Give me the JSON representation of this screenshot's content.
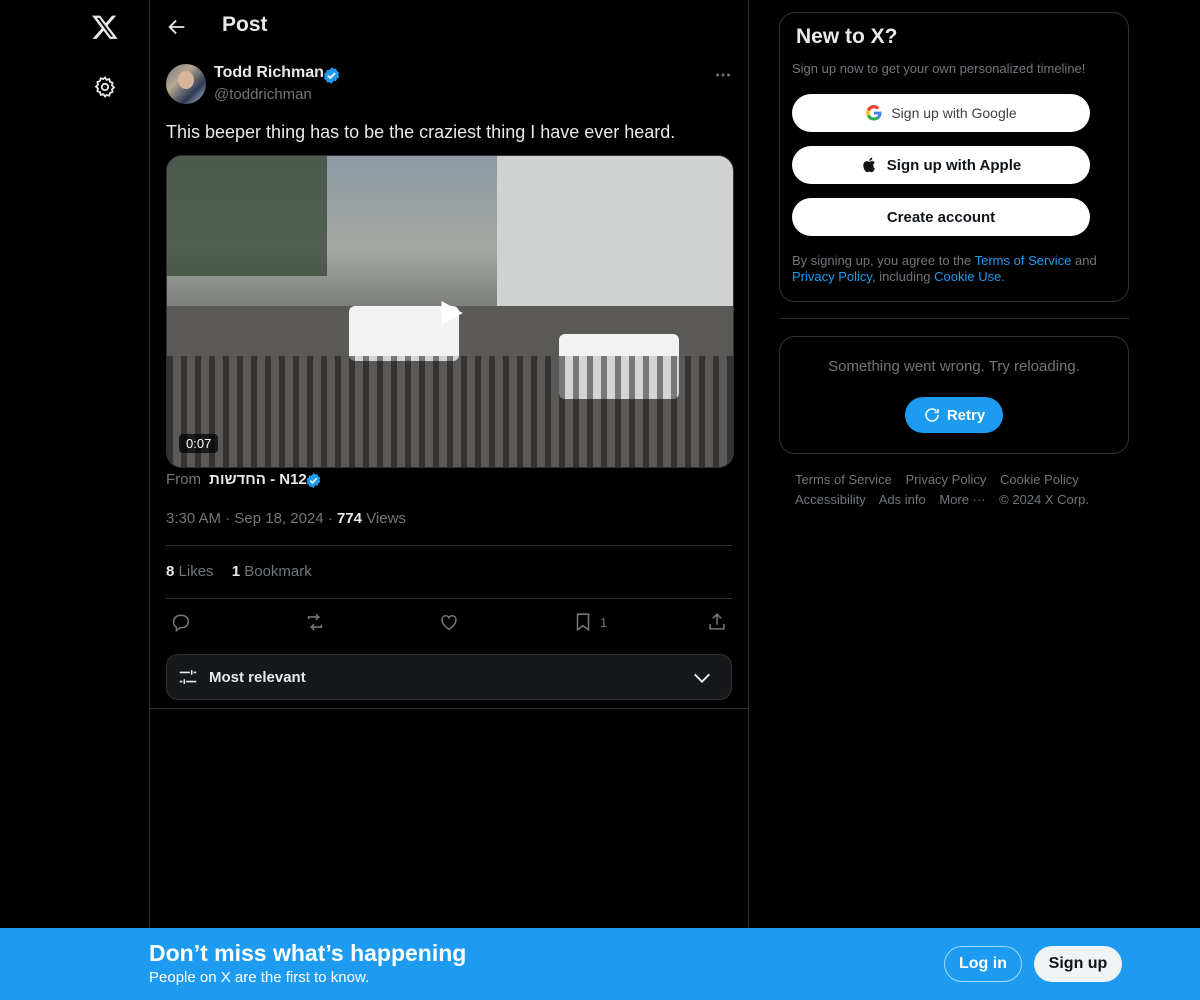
{
  "header": {
    "title": "Post"
  },
  "post": {
    "author_name": "Todd Richman",
    "author_handle": "@toddrichman",
    "text": "This beeper thing has to be the craziest thing I have ever heard.",
    "video_duration": "0:07",
    "from_label": "From",
    "from_source": "החדשות - N12",
    "time": "3:30 AM",
    "date": "Sep 18, 2024",
    "views_count": "774",
    "views_label": "Views",
    "likes_count": "8",
    "likes_label": "Likes",
    "bookmarks_count": "1",
    "bookmarks_label": "Bookmark",
    "bookmark_action_count": "1"
  },
  "replies": {
    "sort_label": "Most relevant"
  },
  "sidebar": {
    "title": "New to X?",
    "subtitle": "Sign up now to get your own personalized timeline!",
    "google_label": "Sign up with Google",
    "apple_label": "Sign up with Apple",
    "create_label": "Create account",
    "legal_prefix": "By signing up, you agree to the ",
    "terms_link": "Terms of Service",
    "legal_and": " and ",
    "privacy_link": "Privacy Policy",
    "legal_including": ", including ",
    "cookie_link": "Cookie Use.",
    "error_text": "Something went wrong. Try reloading.",
    "retry_label": "Retry"
  },
  "footer": {
    "terms": "Terms of Service",
    "privacy": "Privacy Policy",
    "cookie": "Cookie Policy",
    "accessibility": "Accessibility",
    "ads": "Ads info",
    "more": "More ···",
    "copyright": "© 2024 X Corp."
  },
  "banner": {
    "title": "Don’t miss what’s happening",
    "subtitle": "People on X are the first to know.",
    "login_label": "Log in",
    "signup_label": "Sign up"
  },
  "colors": {
    "accent": "#1d9bf0",
    "background": "#000000",
    "border": "#2f3336",
    "muted": "#71767b"
  }
}
